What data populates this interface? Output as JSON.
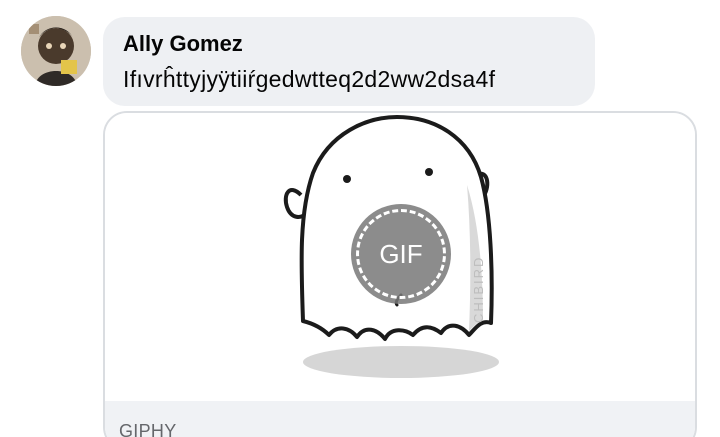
{
  "comment": {
    "author": "Ally Gomez",
    "text": "Ifıvrĥttyjyÿtiiŕgedwtteq2d2ww2dsa4f"
  },
  "attachment": {
    "type": "gif",
    "badge_label": "GIF",
    "watermark": "CHIBIRD",
    "source": "GIPHY"
  }
}
